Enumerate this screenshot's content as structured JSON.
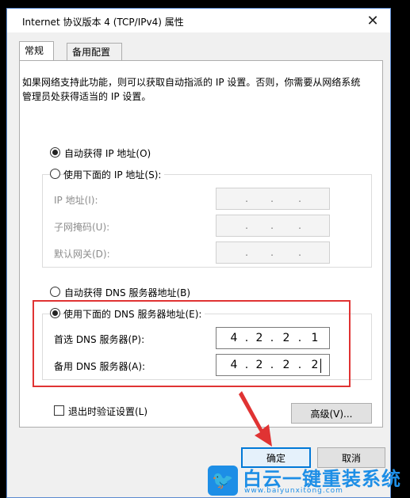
{
  "window": {
    "title": "Internet 协议版本 4 (TCP/IPv4) 属性",
    "close_glyph": "✕"
  },
  "tabs": [
    {
      "label": "常规",
      "active": true
    },
    {
      "label": "备用配置",
      "active": false
    }
  ],
  "description": "如果网络支持此功能，则可以获取自动指派的 IP 设置。否则，你需要从网络系统管理员处获得适当的 IP 设置。",
  "ip": {
    "auto_label": "自动获得 IP 地址(O)",
    "manual_label": "使用下面的 IP 地址(S):",
    "ip_address_label": "IP 地址(I):",
    "subnet_label": "子网掩码(U):",
    "gateway_label": "默认网关(D):"
  },
  "dns": {
    "auto_label": "自动获得 DNS 服务器地址(B)",
    "manual_label": "使用下面的 DNS 服务器地址(E):",
    "preferred_label": "首选 DNS 服务器(P):",
    "alternate_label": "备用 DNS 服务器(A):",
    "preferred_value": [
      "4",
      "2",
      "2",
      "1"
    ],
    "alternate_value": [
      "4",
      "2",
      "2",
      "2"
    ]
  },
  "dot": ".",
  "validate_label": "退出时验证设置(L)",
  "advanced_label": "高级(V)...",
  "ok_label": "确定",
  "cancel_label": "取消",
  "brand": {
    "title": "白云一键重装系统",
    "url": "www.baiyunxitong.com"
  },
  "colors": {
    "highlight": "#e03333",
    "accent": "#0078d7",
    "brand": "#1d8ee6"
  }
}
